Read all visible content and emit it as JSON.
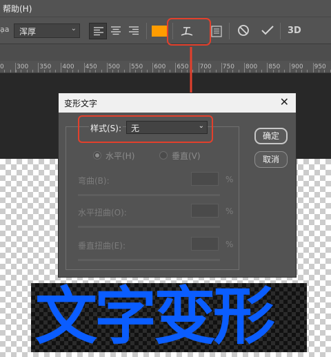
{
  "menubar": {
    "help_label": "帮助(H)"
  },
  "options_bar": {
    "aa_label": "ạa",
    "font_weight": "浑厚",
    "text_color": "#ff9c00"
  },
  "ruler": {
    "labels": [
      "0",
      "300",
      "350",
      "400",
      "450",
      "500",
      "550",
      "600",
      "650",
      "700",
      "750",
      "800",
      "850",
      "900",
      "950"
    ]
  },
  "dialog": {
    "title": "变形文字",
    "close": "✕",
    "style_label": "样式(S):",
    "style_value": "无",
    "horizontal": "水平(H)",
    "vertical": "垂直(V)",
    "bend_label": "弯曲(B):",
    "hdistort_label": "水平扭曲(O):",
    "vdistort_label": "垂直扭曲(E):",
    "percent": "%",
    "ok": "确定",
    "cancel": "取消"
  },
  "canvas": {
    "text": "文字变形",
    "text_color": "#0a5dff"
  },
  "annotation_color": "#e3402c"
}
